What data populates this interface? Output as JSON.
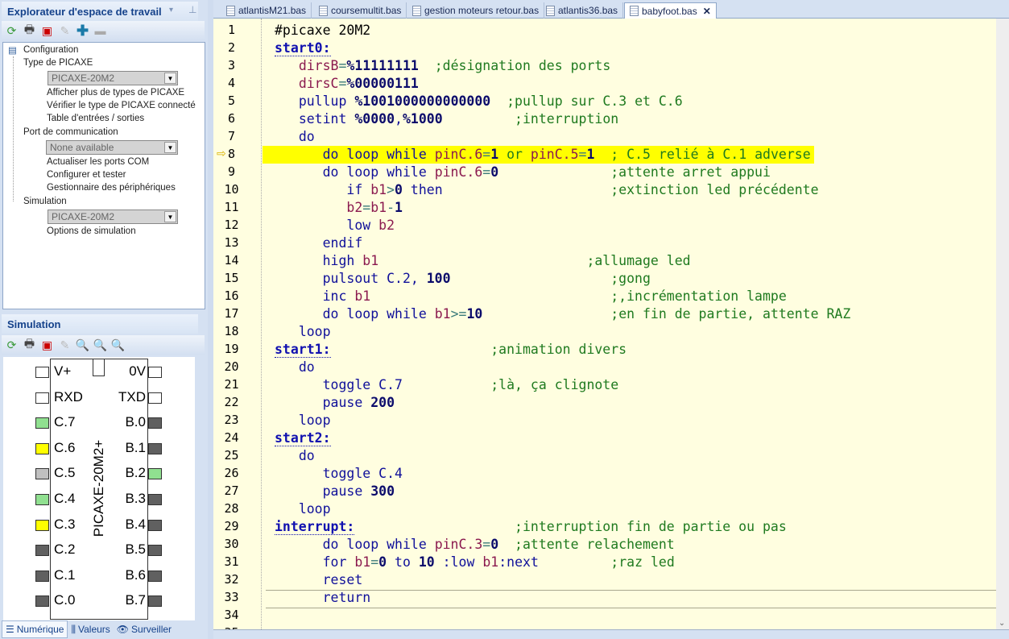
{
  "explorer": {
    "title": "Explorateur d'espace de travail",
    "tree": {
      "root": "Configuration",
      "type_header": "Type de PICAXE",
      "type_value": "PICAXE-20M2",
      "type_items": [
        "Afficher plus de types de PICAXE",
        "Vérifier le type de PICAXE connecté",
        "Table d'entrées / sorties"
      ],
      "port_header": "Port de communication",
      "port_value": "None available",
      "port_items": [
        "Actualiser les ports COM",
        "Configurer et tester",
        "Gestionnaire des périphériques"
      ],
      "sim_header": "Simulation",
      "sim_value": "PICAXE-20M2",
      "sim_items": [
        "Options de simulation"
      ]
    }
  },
  "simulation": {
    "title": "Simulation",
    "chip_name": "PICAXE-20M2+",
    "left_pins": [
      {
        "label": "V+",
        "color": "#ffffff"
      },
      {
        "label": "RXD",
        "color": "#ffffff"
      },
      {
        "label": "C.7",
        "color": "#90e090"
      },
      {
        "label": "C.6",
        "color": "#ffff00"
      },
      {
        "label": "C.5",
        "color": "#c0c0c0"
      },
      {
        "label": "C.4",
        "color": "#90e090"
      },
      {
        "label": "C.3",
        "color": "#ffff00"
      },
      {
        "label": "C.2",
        "color": "#606060"
      },
      {
        "label": "C.1",
        "color": "#606060"
      },
      {
        "label": "C.0",
        "color": "#606060"
      }
    ],
    "right_pins": [
      {
        "label": "0V",
        "color": "#ffffff"
      },
      {
        "label": "TXD",
        "color": "#ffffff"
      },
      {
        "label": "B.0",
        "color": "#606060"
      },
      {
        "label": "B.1",
        "color": "#606060"
      },
      {
        "label": "B.2",
        "color": "#90e090"
      },
      {
        "label": "B.3",
        "color": "#606060"
      },
      {
        "label": "B.4",
        "color": "#606060"
      },
      {
        "label": "B.5",
        "color": "#606060"
      },
      {
        "label": "B.6",
        "color": "#606060"
      },
      {
        "label": "B.7",
        "color": "#606060"
      }
    ],
    "tabs": [
      "Numérique",
      "Valeurs",
      "Surveiller"
    ]
  },
  "editor": {
    "tabs": [
      "atlantisM21.bas",
      "coursemultit.bas",
      "gestion moteurs retour.bas",
      "atlantis36.bas",
      "babyfoot.bas"
    ],
    "active_tab": 4,
    "current_line": 8,
    "lines": [
      [
        [
          "tx",
          "#picaxe 20M2"
        ]
      ],
      [
        [
          "lab",
          "start0:"
        ]
      ],
      [
        [
          "tx",
          "   "
        ],
        [
          "var",
          "dirsB"
        ],
        [
          "op",
          "="
        ],
        [
          "num",
          "%11111111"
        ],
        [
          "tx",
          "  "
        ],
        [
          "com",
          ";désignation des ports"
        ]
      ],
      [
        [
          "tx",
          "   "
        ],
        [
          "var",
          "dirsC"
        ],
        [
          "op",
          "="
        ],
        [
          "num",
          "%00000111"
        ]
      ],
      [
        [
          "tx",
          "   "
        ],
        [
          "kw",
          "pullup "
        ],
        [
          "num",
          "%1001000000000000"
        ],
        [
          "tx",
          "  "
        ],
        [
          "com",
          ";pullup sur C.3 et C.6"
        ]
      ],
      [
        [
          "tx",
          "   "
        ],
        [
          "kw",
          "setint "
        ],
        [
          "num",
          "%0000"
        ],
        [
          "kw",
          ","
        ],
        [
          "num",
          "%1000"
        ],
        [
          "tx",
          "         "
        ],
        [
          "com",
          ";interruption"
        ]
      ],
      [
        [
          "tx",
          "   "
        ],
        [
          "kw",
          "do"
        ]
      ],
      [
        [
          "tx",
          "      "
        ],
        [
          "kw",
          "do loop while "
        ],
        [
          "var",
          "pinC.6"
        ],
        [
          "op",
          "="
        ],
        [
          "num",
          "1"
        ],
        [
          "com",
          " or "
        ],
        [
          "var",
          "pinC.5"
        ],
        [
          "op",
          "="
        ],
        [
          "num",
          "1"
        ],
        [
          "tx",
          "  "
        ],
        [
          "com",
          "; C.5 relié à C.1 adverse"
        ]
      ],
      [
        [
          "tx",
          "      "
        ],
        [
          "kw",
          "do loop while "
        ],
        [
          "var",
          "pinC.6"
        ],
        [
          "op",
          "="
        ],
        [
          "num",
          "0"
        ],
        [
          "tx",
          "              "
        ],
        [
          "com",
          ";attente arret appui"
        ]
      ],
      [
        [
          "tx",
          "         "
        ],
        [
          "kw",
          "if "
        ],
        [
          "var",
          "b1"
        ],
        [
          "op",
          ">"
        ],
        [
          "num",
          "0"
        ],
        [
          "kw",
          " then"
        ],
        [
          "tx",
          "                     "
        ],
        [
          "com",
          ";extinction led précédente"
        ]
      ],
      [
        [
          "tx",
          "         "
        ],
        [
          "var",
          "b2"
        ],
        [
          "op",
          "="
        ],
        [
          "var",
          "b1"
        ],
        [
          "op",
          "-"
        ],
        [
          "num",
          "1"
        ]
      ],
      [
        [
          "tx",
          "         "
        ],
        [
          "kw",
          "low "
        ],
        [
          "var",
          "b2"
        ]
      ],
      [
        [
          "tx",
          "      "
        ],
        [
          "kw",
          "endif"
        ]
      ],
      [
        [
          "tx",
          "      "
        ],
        [
          "kw",
          "high "
        ],
        [
          "var",
          "b1"
        ],
        [
          "tx",
          "                          "
        ],
        [
          "com",
          ";allumage led"
        ]
      ],
      [
        [
          "tx",
          "      "
        ],
        [
          "kw",
          "pulsout C.2, "
        ],
        [
          "num",
          "100"
        ],
        [
          "tx",
          "                    "
        ],
        [
          "com",
          ";gong"
        ]
      ],
      [
        [
          "tx",
          "      "
        ],
        [
          "kw",
          "inc "
        ],
        [
          "var",
          "b1"
        ],
        [
          "tx",
          "                              "
        ],
        [
          "com",
          ";,incrémentation lampe"
        ]
      ],
      [
        [
          "tx",
          "      "
        ],
        [
          "kw",
          "do loop while "
        ],
        [
          "var",
          "b1"
        ],
        [
          "op",
          ">="
        ],
        [
          "num",
          "10"
        ],
        [
          "tx",
          "                "
        ],
        [
          "com",
          ";en fin de partie, attente RAZ"
        ]
      ],
      [
        [
          "tx",
          "   "
        ],
        [
          "kw",
          "loop"
        ]
      ],
      [
        [
          "lab",
          "start1:"
        ],
        [
          "tx",
          "                    "
        ],
        [
          "com",
          ";animation divers"
        ]
      ],
      [
        [
          "tx",
          "   "
        ],
        [
          "kw",
          "do"
        ]
      ],
      [
        [
          "tx",
          "      "
        ],
        [
          "kw",
          "toggle C.7"
        ],
        [
          "tx",
          "           "
        ],
        [
          "com",
          ";là, ça clignote"
        ]
      ],
      [
        [
          "tx",
          "      "
        ],
        [
          "kw",
          "pause "
        ],
        [
          "num",
          "200"
        ]
      ],
      [
        [
          "tx",
          "   "
        ],
        [
          "kw",
          "loop"
        ]
      ],
      [
        [
          "lab",
          "start2:"
        ]
      ],
      [
        [
          "tx",
          "   "
        ],
        [
          "kw",
          "do"
        ]
      ],
      [
        [
          "tx",
          "      "
        ],
        [
          "kw",
          "toggle C.4"
        ]
      ],
      [
        [
          "tx",
          "      "
        ],
        [
          "kw",
          "pause "
        ],
        [
          "num",
          "300"
        ]
      ],
      [
        [
          "tx",
          "   "
        ],
        [
          "kw",
          "loop"
        ]
      ],
      [
        [
          "lab",
          "interrupt:"
        ],
        [
          "tx",
          "                    "
        ],
        [
          "com",
          ";interruption fin de partie ou pas"
        ]
      ],
      [
        [
          "tx",
          "      "
        ],
        [
          "kw",
          "do loop while "
        ],
        [
          "var",
          "pinC.3"
        ],
        [
          "op",
          "="
        ],
        [
          "num",
          "0"
        ],
        [
          "tx",
          "  "
        ],
        [
          "com",
          ";attente relachement"
        ]
      ],
      [
        [
          "tx",
          "      "
        ],
        [
          "kw",
          "for "
        ],
        [
          "var",
          "b1"
        ],
        [
          "op",
          "="
        ],
        [
          "num",
          "0"
        ],
        [
          "kw",
          " to "
        ],
        [
          "num",
          "10"
        ],
        [
          "kw",
          " :low "
        ],
        [
          "var",
          "b1"
        ],
        [
          "kw",
          ":next"
        ],
        [
          "tx",
          "         "
        ],
        [
          "com",
          ";raz led"
        ]
      ],
      [
        [
          "tx",
          "      "
        ],
        [
          "kw",
          "reset"
        ]
      ],
      [
        [
          "tx",
          "      "
        ],
        [
          "kw",
          "return"
        ]
      ],
      [],
      []
    ]
  }
}
